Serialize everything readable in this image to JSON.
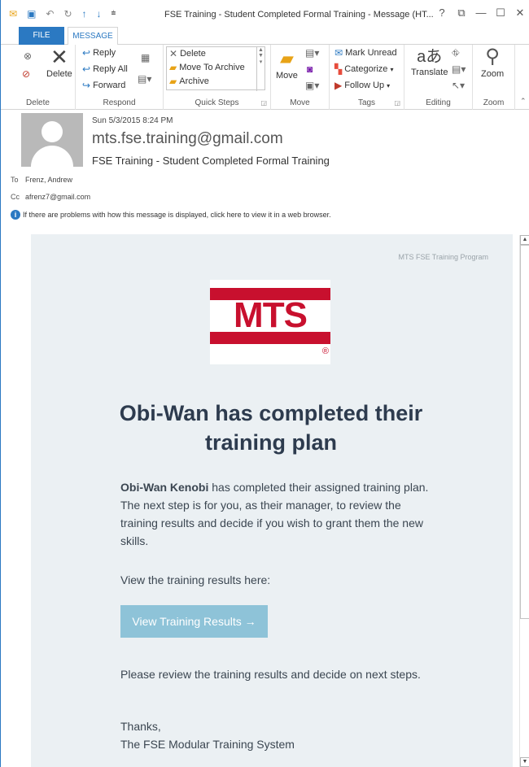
{
  "window": {
    "title": "FSE Training - Student Completed Formal Training - Message (HT...",
    "controls": [
      "?",
      "⧉",
      "—",
      "☐",
      "✕"
    ]
  },
  "tabs": [
    {
      "label": "FILE"
    },
    {
      "label": "MESSAGE"
    }
  ],
  "ribbon": {
    "delete_group": {
      "label": "Delete",
      "delete_label": "Delete"
    },
    "respond_group": {
      "label": "Respond",
      "reply": "Reply",
      "reply_all": "Reply All",
      "forward": "Forward"
    },
    "quick_steps_group": {
      "label": "Quick Steps",
      "items": [
        "Delete",
        "Move To Archive",
        "Archive"
      ]
    },
    "move_group": {
      "label": "Move",
      "move_label": "Move"
    },
    "tags_group": {
      "label": "Tags",
      "mark_unread": "Mark Unread",
      "categorize": "Categorize",
      "follow_up": "Follow Up"
    },
    "editing_group": {
      "label": "Editing",
      "translate": "Translate"
    },
    "zoom_group": {
      "label": "Zoom",
      "zoom_label": "Zoom"
    }
  },
  "header": {
    "date": "Sun 5/3/2015 8:24 PM",
    "from": "mts.fse.training@gmail.com",
    "subject": "FSE Training - Student Completed Formal Training",
    "to_label": "To",
    "to": "Frenz, Andrew",
    "cc_label": "Cc",
    "cc": "afrenz7@gmail.com",
    "info": "If there are problems with how this message is displayed, click here to view it in a web browser."
  },
  "body": {
    "program": "MTS FSE Training Program",
    "logo_text": "MTS",
    "logo_reg": "®",
    "headline": "Obi-Wan has completed their training plan",
    "student_name": "Obi-Wan Kenobi",
    "paragraph1_rest": " has completed their assigned training plan. The next step is for you, as their manager, to review the training results and decide if you wish to grant them the new skills.",
    "paragraph2": "View the training results here:",
    "cta": "View Training Results →",
    "paragraph3": "Please review the training results and decide on next steps.",
    "signoff": "Thanks,",
    "signature": "The FSE Modular Training System"
  },
  "colors": {
    "accent": "#2b79c2",
    "card_bg": "#ebf0f3",
    "brand_red": "#c8102e",
    "cta_bg": "#8ec3d8",
    "headline": "#2d3b4e"
  }
}
